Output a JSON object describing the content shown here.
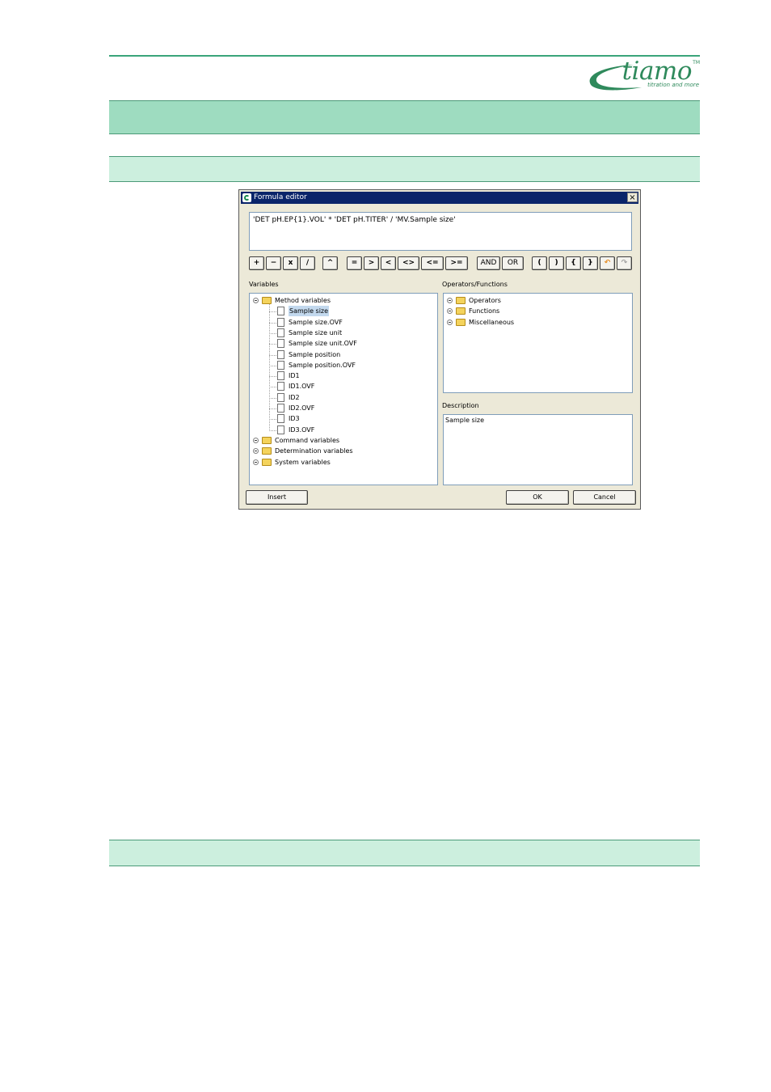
{
  "logo": {
    "word": "tiamo",
    "trademark": "TM",
    "tagline": "titration and more"
  },
  "dialog": {
    "title": "Formula editor",
    "close_symbol": "×",
    "formula_text": "'DET pH.EP{1}.VOL'  *  'DET pH.TITER'  /  'MV.Sample size'",
    "toolbar": [
      {
        "label": "+",
        "name": "plus-button"
      },
      {
        "label": "−",
        "name": "minus-button"
      },
      {
        "label": "x",
        "name": "multiply-button"
      },
      {
        "label": "/",
        "name": "divide-button"
      },
      {
        "label": "^",
        "name": "power-button"
      },
      {
        "label": "=",
        "name": "equal-button"
      },
      {
        "label": ">",
        "name": "greater-button"
      },
      {
        "label": "<",
        "name": "less-button"
      },
      {
        "label": "<>",
        "name": "not-equal-button"
      },
      {
        "label": "<=",
        "name": "less-equal-button"
      },
      {
        "label": ">=",
        "name": "greater-equal-button"
      },
      {
        "label": "AND",
        "name": "and-button"
      },
      {
        "label": "OR",
        "name": "or-button"
      },
      {
        "label": "(",
        "name": "open-paren-button"
      },
      {
        "label": ")",
        "name": "close-paren-button"
      },
      {
        "label": "{",
        "name": "open-brace-button"
      },
      {
        "label": "}",
        "name": "close-brace-button"
      },
      {
        "label": "↶",
        "name": "undo-button"
      },
      {
        "label": "↷",
        "name": "redo-button"
      }
    ],
    "variables_label": "Variables",
    "variables_tree": {
      "root": "Method variables",
      "children": [
        "Sample size",
        "Sample size.OVF",
        "Sample size unit",
        "Sample size unit.OVF",
        "Sample position",
        "Sample position.OVF",
        "ID1",
        "ID1.OVF",
        "ID2",
        "ID2.OVF",
        "ID3",
        "ID3.OVF"
      ],
      "selected": "Sample size",
      "other_roots": [
        "Command variables",
        "Determination variables",
        "System variables"
      ]
    },
    "operators_label": "Operators/Functions",
    "operators_tree": [
      "Operators",
      "Functions",
      "Miscellaneous"
    ],
    "description_label": "Description",
    "description_text": "Sample size",
    "buttons": {
      "insert": "Insert",
      "ok": "OK",
      "cancel": "Cancel"
    }
  }
}
